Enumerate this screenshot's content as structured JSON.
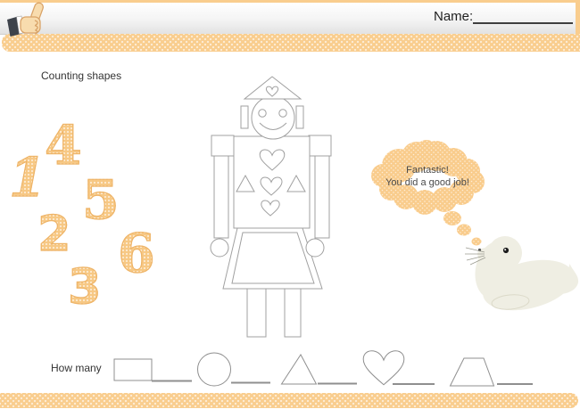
{
  "header": {
    "name_label": "Name:"
  },
  "worksheet": {
    "title": "Counting shapes",
    "scattered_numbers": [
      "4",
      "1",
      "5",
      "2",
      "6",
      "3"
    ],
    "speech_bubble": {
      "line1": "Fantastic!",
      "line2": "You did a good job!"
    },
    "prompt": "How many",
    "count_shapes": [
      "rectangle",
      "circle",
      "triangle",
      "heart",
      "trapezoid"
    ]
  },
  "icons": {
    "badge": "thumbs-up-icon"
  },
  "colors": {
    "band_orange": "#f9cd8e",
    "number_orange": "#f7c884",
    "robot_outline": "#a0a0a0",
    "answer_line_gray": "#8f8f8f",
    "seal_cream": "#efeee3",
    "text_dark": "#333333"
  }
}
